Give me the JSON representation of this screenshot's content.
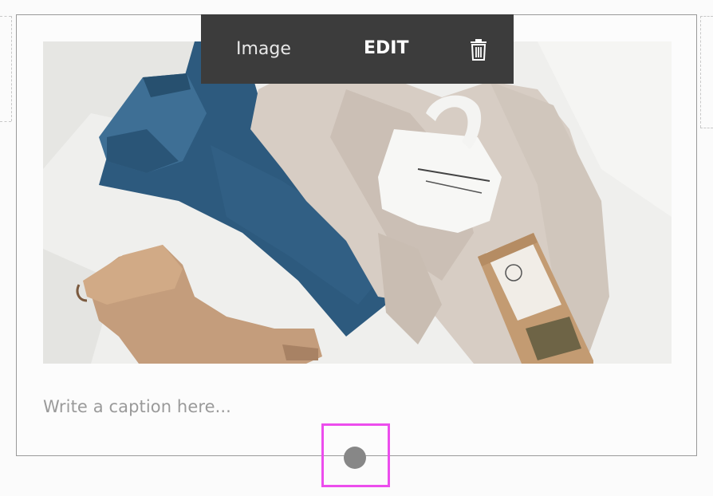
{
  "toolbar": {
    "block_type_label": "Image",
    "edit_label": "EDIT",
    "delete_icon": "trash-icon"
  },
  "image": {
    "description_icon": "photo"
  },
  "caption": {
    "placeholder": "Write a caption here..."
  },
  "resize_handle": {
    "icon": "drag-handle-dot"
  },
  "colors": {
    "toolbar_bg": "#3c3c3c",
    "highlight": "#ec4ded",
    "handle": "#878787",
    "caption_text": "#9a9a9a"
  }
}
